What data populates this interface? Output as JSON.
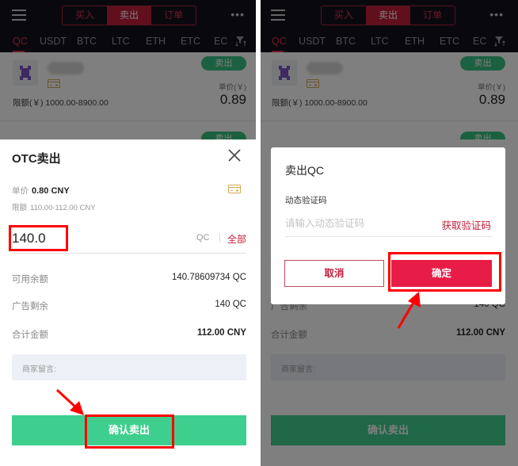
{
  "header": {
    "segments": [
      "买入",
      "卖出",
      "订单"
    ],
    "active_segment": "卖出",
    "coins": [
      "QC",
      "USDT",
      "BTC",
      "LTC",
      "ETH",
      "ETC",
      "EC"
    ],
    "active_coin": "QC"
  },
  "listing": {
    "sell_label": "卖出",
    "limit": "限额(￥) 1000.00-8900.00",
    "price_label": "单价(￥)",
    "price": "0.89"
  },
  "sell_sheet": {
    "title": "OTC卖出",
    "unit_price_label": "单价",
    "unit_price": "0.80 CNY",
    "limit_label": "限额",
    "limit": "110.00-112.00 CNY",
    "amount_value": "140.0",
    "amount_unit": "QC",
    "all_label": "全部",
    "rows": [
      {
        "label": "可用余额",
        "value": "140.78609734 QC"
      },
      {
        "label": "广告剩余",
        "value": "140 QC"
      },
      {
        "label": "合计金额",
        "value": "112.00 CNY"
      }
    ],
    "note_label": "商家留言:",
    "confirm_label": "确认卖出"
  },
  "verify_dialog": {
    "title": "卖出QC",
    "code_label": "动态验证码",
    "code_placeholder": "请输入动态验证码",
    "code_value": "",
    "get_code_label": "获取验证码",
    "cancel_label": "取消",
    "ok_label": "确定"
  },
  "colors": {
    "brand_red": "#c21d3a",
    "confirm_green": "#3ecf8e",
    "ok_red": "#e81d47",
    "header_bg": "#13121a",
    "annotation_red": "#ff0000"
  }
}
